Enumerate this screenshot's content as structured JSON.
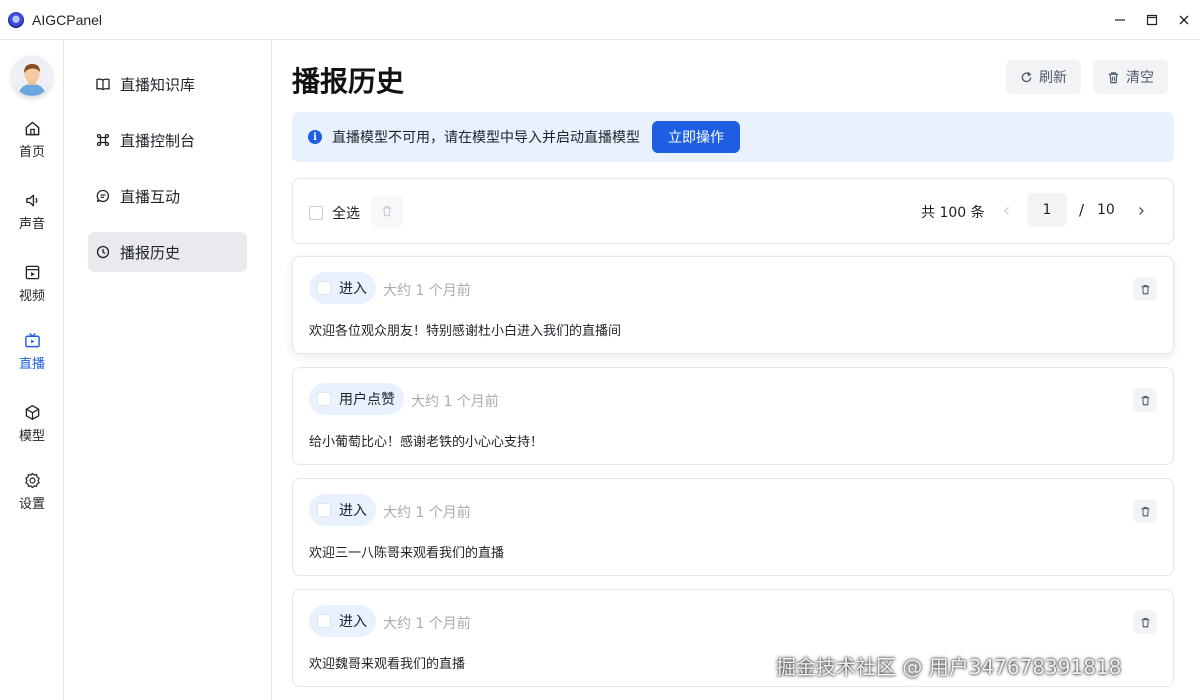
{
  "window": {
    "title": "AIGCPanel"
  },
  "rail": {
    "items": [
      {
        "label": "首页",
        "icon": "home-icon"
      },
      {
        "label": "声音",
        "icon": "sound-icon"
      },
      {
        "label": "视频",
        "icon": "video-icon"
      },
      {
        "label": "直播",
        "icon": "live-tv-icon",
        "active": true
      },
      {
        "label": "模型",
        "icon": "cube-icon"
      },
      {
        "label": "设置",
        "icon": "gear-icon"
      }
    ]
  },
  "submenu": {
    "items": [
      {
        "label": "直播知识库",
        "icon": "book-icon"
      },
      {
        "label": "直播控制台",
        "icon": "command-icon"
      },
      {
        "label": "直播互动",
        "icon": "chat-icon"
      },
      {
        "label": "播报历史",
        "icon": "history-icon",
        "active": true
      }
    ]
  },
  "page": {
    "title": "播报历史",
    "refresh_label": "刷新",
    "clear_label": "清空"
  },
  "alert": {
    "text": "直播模型不可用，请在模型中导入并启动直播模型",
    "action_label": "立即操作"
  },
  "toolbar": {
    "select_all_label": "全选",
    "total_text": "共 100 条",
    "current_page": "1",
    "page_separator": "/",
    "total_pages": "10"
  },
  "messages": [
    {
      "tag": "进入",
      "time": "大约 1 个月前",
      "text": "欢迎各位观众朋友！特别感谢杜小白进入我们的直播间"
    },
    {
      "tag": "用户点赞",
      "time": "大约 1 个月前",
      "text": "给小葡萄比心！感谢老铁的小心心支持！"
    },
    {
      "tag": "进入",
      "time": "大约 1 个月前",
      "text": "欢迎三一八陈哥来观看我们的直播"
    },
    {
      "tag": "进入",
      "time": "大约 1 个月前",
      "text": "欢迎魏哥来观看我们的直播"
    }
  ],
  "watermark": "掘金技术社区 @ 用户347678391818",
  "colors": {
    "accent": "#1e5ee3",
    "alert_bg": "#e8f1fd",
    "active_menu_bg": "#e8eaed",
    "muted_text": "#a8abb2"
  }
}
